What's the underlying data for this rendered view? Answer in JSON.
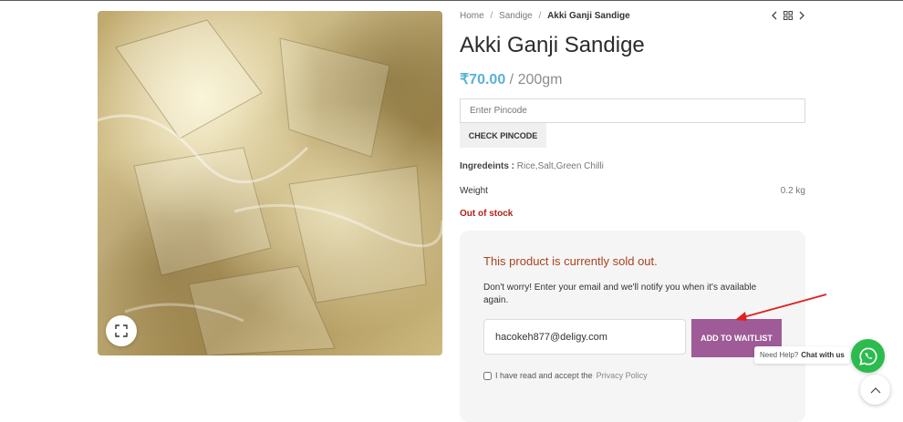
{
  "breadcrumb": {
    "home": "Home",
    "category": "Sandige",
    "current": "Akki Ganji Sandige",
    "sep": "/"
  },
  "nav": {
    "prev_icon": "chevron-left-icon",
    "grid_icon": "grid-icon",
    "next_icon": "chevron-right-icon"
  },
  "product": {
    "title": "Akki Ganji Sandige",
    "price": "₹70.00",
    "unit": "/ 200gm",
    "ingredients_label": "Ingredeints :",
    "ingredients_value": "Rice,Salt,Green Chilli",
    "weight_label": "Weight",
    "weight_value": "0.2 kg",
    "stock_status": "Out of stock"
  },
  "pincode": {
    "placeholder": "Enter Pincode",
    "button": "CHECK PINCODE"
  },
  "waitlist": {
    "title": "This product is currently sold out.",
    "description": "Don't worry! Enter your email and we'll notify you when it's available again.",
    "email_value": "hacokeh877@deligy.com",
    "button": "ADD TO WAITLIST",
    "agree_text": "I have read and accept the",
    "agree_link": "Privacy Policy"
  },
  "chat": {
    "help_text": "Need Help?",
    "chat_link": "Chat with us"
  },
  "colors": {
    "price": "#5ab1d6",
    "stock": "#b2231a",
    "waitlist_button": "#9e5b97",
    "whatsapp": "#2cbb4f",
    "annotation_arrow": "#e02020"
  }
}
